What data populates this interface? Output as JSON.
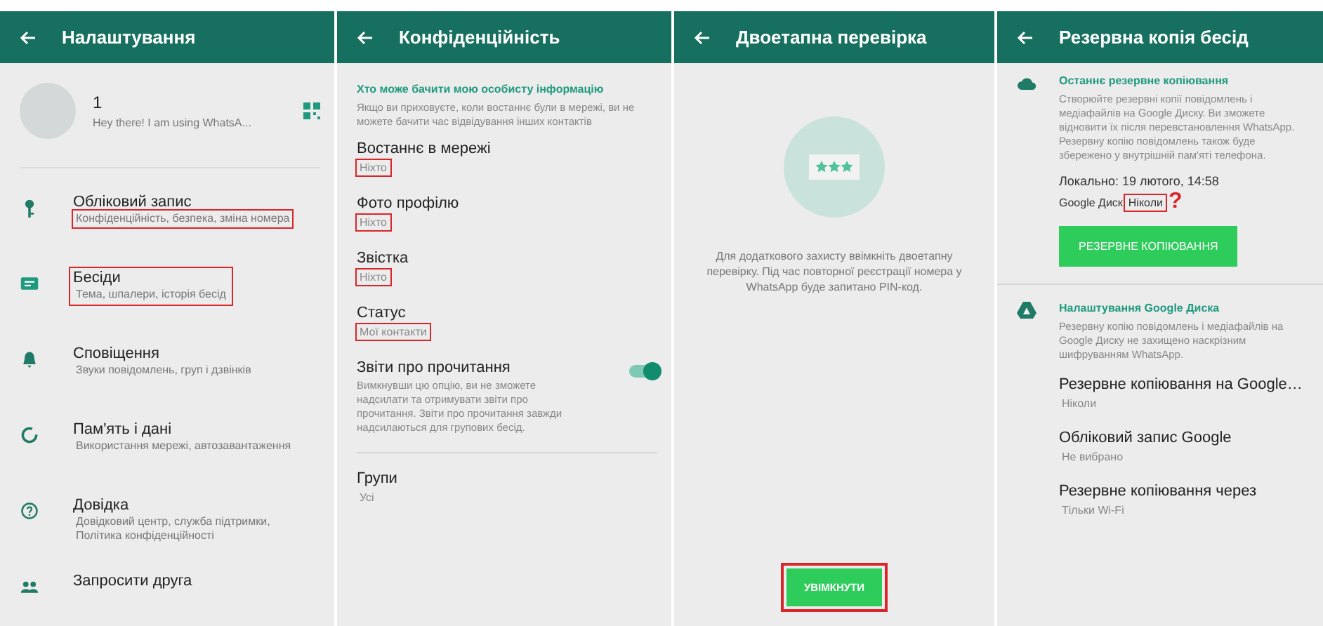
{
  "settings": {
    "title": "Налаштування",
    "profile": {
      "name": "1",
      "about": "Hey there! I am using WhatsA..."
    },
    "items": [
      {
        "kind": "key",
        "title": "Обліковий запис",
        "subtitle": "Конфіденційність, безпека, зміна номера",
        "title_highlighted": false,
        "subtitle_highlighted": true
      },
      {
        "kind": "chat",
        "title": "Бесіди",
        "subtitle": "Тема, шпалери, історія бесід",
        "title_highlighted": true,
        "subtitle_highlighted": true
      },
      {
        "kind": "bell",
        "title": "Сповіщення",
        "subtitle": "Звуки повідомлень, груп і дзвінків",
        "title_highlighted": false,
        "subtitle_highlighted": false
      },
      {
        "kind": "data",
        "title": "Пам'ять і дані",
        "subtitle": "Використання мережі, автозавантаження",
        "title_highlighted": false,
        "subtitle_highlighted": false
      },
      {
        "kind": "help",
        "title": "Довідка",
        "subtitle": "Довідковий центр, служба підтримки, Політика конфіденційності",
        "title_highlighted": false,
        "subtitle_highlighted": false
      },
      {
        "kind": "people",
        "title": "Запросити друга",
        "title_highlighted": false
      }
    ]
  },
  "privacy": {
    "title": "Конфіденційність",
    "section_title": "Хто може бачити мою особисту інформацію",
    "section_note": "Якщо ви приховуєте, коли востаннє були в мережі, ви не можете бачити час відвідування інших контактів",
    "items": [
      {
        "kind": "option",
        "title": "Востаннє в мережі",
        "value": "Ніхто",
        "highlighted": true
      },
      {
        "kind": "option",
        "title": "Фото профілю",
        "value": "Ніхто",
        "highlighted": true
      },
      {
        "kind": "option",
        "title": "Звістка",
        "value": "Ніхто",
        "highlighted": true
      },
      {
        "kind": "option",
        "title": "Статус",
        "value": "Мої контакти",
        "highlighted": true
      },
      {
        "kind": "toggle",
        "title": "Звіти про прочитання",
        "value": "Вимкнувши цю опцію, ви не зможете надсилати та отримувати звіти про прочитання. Звіти про прочитання завжди надсилаються для групових бесід.",
        "on": true
      },
      {
        "kind": "option",
        "title": "Групи",
        "value": "Усі",
        "highlighted": false,
        "divider": true
      }
    ]
  },
  "two_step": {
    "title": "Двоетапна перевірка",
    "note": "Для додаткового захисту ввімкніть двоетапну перевірку. Під час повторної реєстрації номера у WhatsApp буде запитано PIN-код.",
    "button": {
      "label": "УВІМКНУТИ",
      "highlighted": true
    }
  },
  "backup": {
    "title": "Резервна копія бесід",
    "last_backup": {
      "title": "Останнє резервне копіювання",
      "description": "Створюйте резервні копії повідомлень і медіафайлів на Google Диску. Ви зможете відновити їх після перевстановлення WhatsApp. Резервну копію повідомлень також буде збережено у внутрішній пам'яті телефона.",
      "local": "Локально: 19 лютого, 14:58",
      "drive_label": "Google Диск",
      "drive_value": "Ніколи",
      "drive_value_highlighted": true,
      "annotation": "?",
      "button": "РЕЗЕРВНЕ КОПІЮВАННЯ"
    },
    "drive_settings": {
      "title": "Налаштування Google Диска",
      "description": "Резервну копію повідомлень і медіафайлів на Google Диску не захищено наскрізним шифруванням WhatsApp."
    },
    "items": [
      {
        "title": "Резервне копіювання на Google…",
        "value": "Ніколи"
      },
      {
        "title": "Обліковий запис Google",
        "value": "Не вибрано"
      },
      {
        "title": "Резервне копіювання через",
        "value": "Тільки Wi-Fi"
      }
    ]
  }
}
